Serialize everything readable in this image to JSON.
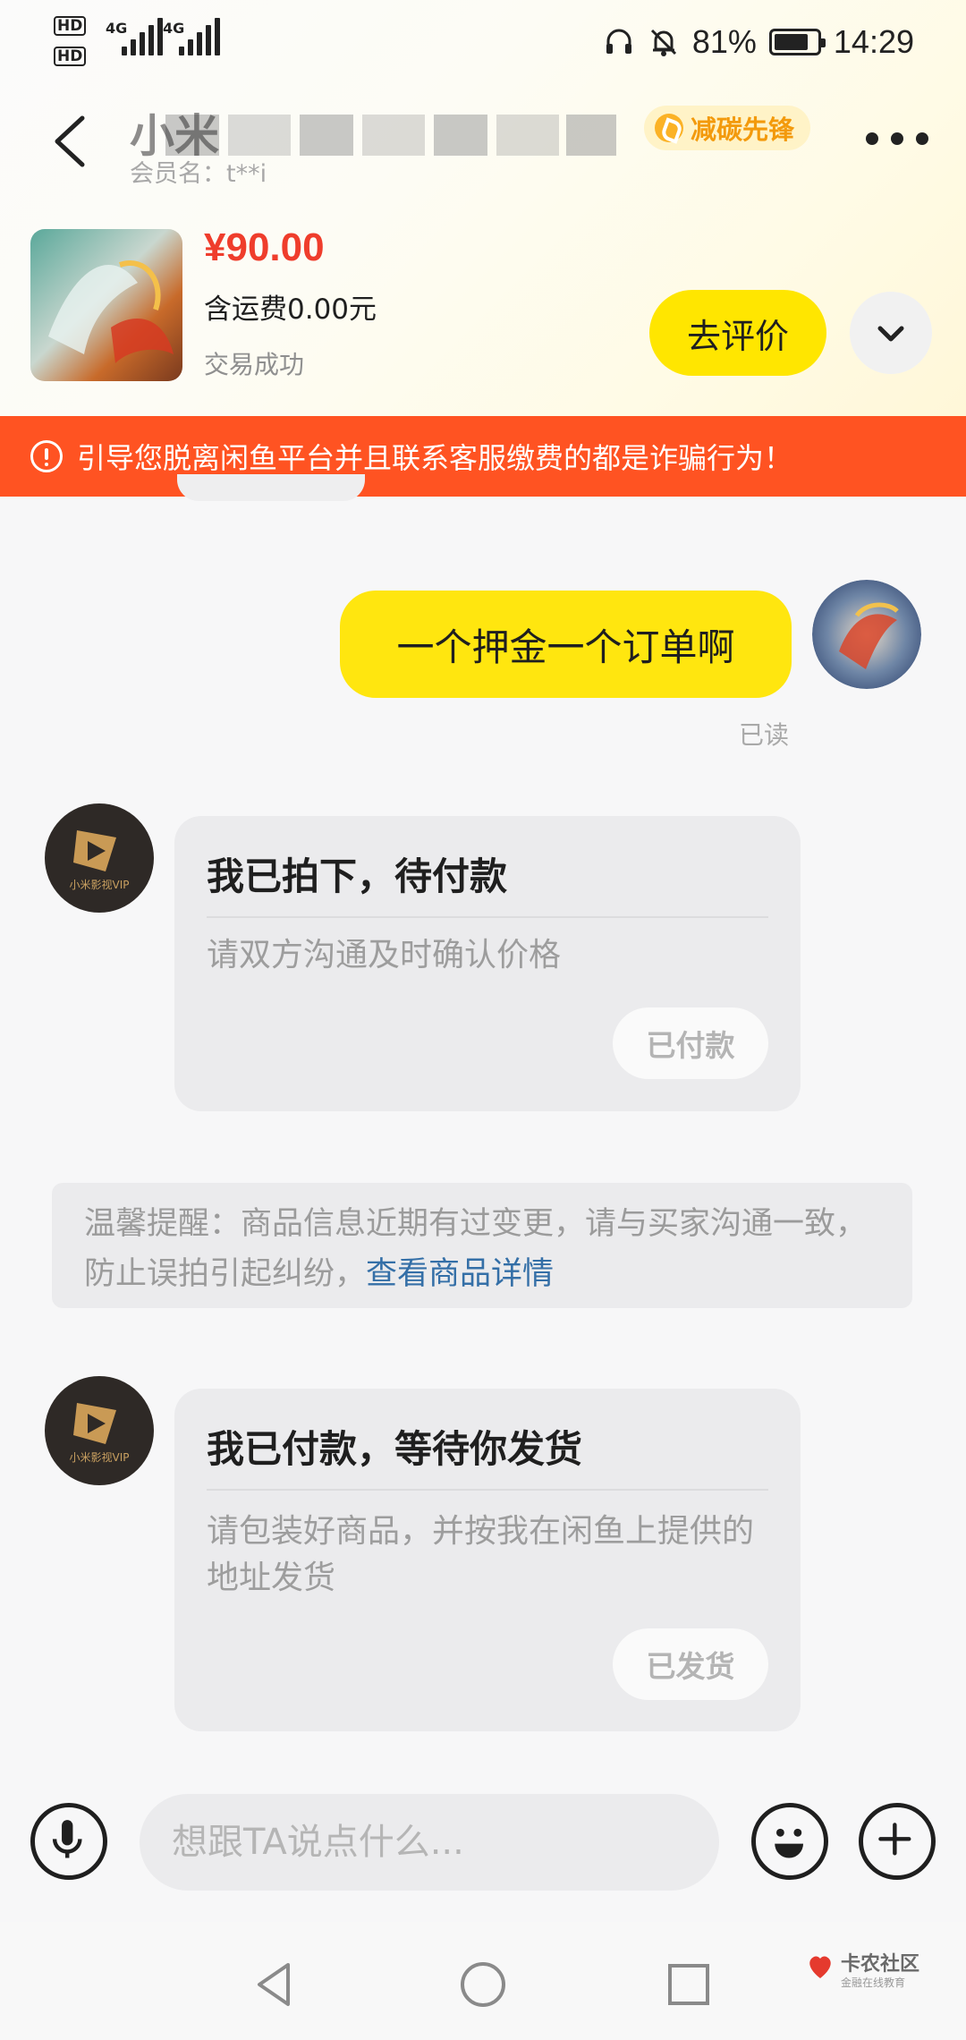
{
  "status_bar": {
    "hd1": "HD",
    "hd2": "HD",
    "network1": "4G",
    "network2": "4G",
    "battery_percent": "81%",
    "battery_level": 0.81,
    "time": "14:29"
  },
  "header": {
    "title_visible_char": "小米",
    "eco_badge": "减碳先锋",
    "member_label": "会员名：t**i"
  },
  "order": {
    "price": "¥90.00",
    "shipping": "含运费0.00元",
    "status": "交易成功",
    "review_button": "去评价"
  },
  "warning": {
    "text": "引导您脱离闲鱼平台并且联系客服缴费的都是诈骗行为！"
  },
  "chat": {
    "my_message": "一个押金一个订单啊",
    "read_status": "已读",
    "seller_avatar_caption": "小米影视VIP",
    "card1": {
      "title": "我已拍下，待付款",
      "desc": "请双方沟通及时确认价格",
      "button": "已付款"
    },
    "tip": {
      "text": "温馨提醒：商品信息近期有过变更，请与买家沟通一致，防止误拍引起纠纷，",
      "link": "查看商品详情"
    },
    "card2": {
      "title": "我已付款，等待你发货",
      "desc": "请包装好商品，并按我在闲鱼上提供的地址发货",
      "button": "已发货"
    }
  },
  "input": {
    "placeholder": "想跟TA说点什么..."
  },
  "watermark": {
    "name": "卡农社区",
    "sub": "金融在线教育"
  },
  "colors": {
    "accent_yellow": "#ffe600",
    "warning_red": "#ff5322",
    "price_red": "#ef3d2c",
    "link_blue": "#346fa7"
  }
}
